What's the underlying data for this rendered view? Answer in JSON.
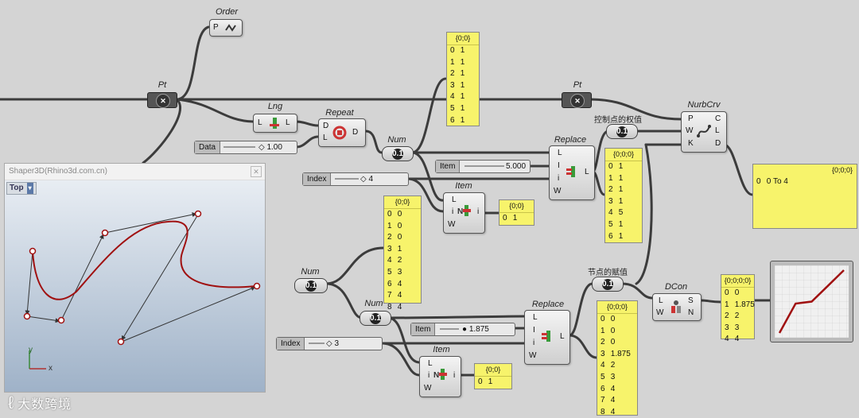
{
  "order": {
    "label": "Order",
    "port": "P"
  },
  "pt1": {
    "label": "Pt"
  },
  "lng": {
    "label": "Lng",
    "in": "L",
    "out": "L"
  },
  "repeat": {
    "label": "Repeat",
    "in1": "D",
    "in2": "L",
    "out": "D"
  },
  "num1": {
    "label": "Num",
    "badge": "0.1"
  },
  "data_slider": {
    "label": "Data",
    "value": "1.00"
  },
  "index1": {
    "label": "Index",
    "value": "4"
  },
  "item1": {
    "label": "Item",
    "in1": "L",
    "in2": "i",
    "in3": "W",
    "out": "i"
  },
  "panel_item1": {
    "header": "{0;0}",
    "rows": [
      {
        "i": "0",
        "v": "1"
      }
    ]
  },
  "panel_weights": {
    "header": "{0;0}",
    "rows": [
      {
        "i": "0",
        "v": "1"
      },
      {
        "i": "1",
        "v": "1"
      },
      {
        "i": "2",
        "v": "1"
      },
      {
        "i": "3",
        "v": "1"
      },
      {
        "i": "4",
        "v": "1"
      },
      {
        "i": "5",
        "v": "1"
      },
      {
        "i": "6",
        "v": "1"
      }
    ]
  },
  "pt2": {
    "label": "Pt"
  },
  "replace1": {
    "label": "Replace",
    "in1": "L",
    "in2": "I",
    "in3": "i",
    "in4": "W",
    "out": "L"
  },
  "item_slider1": {
    "label": "Item",
    "value": "5.000"
  },
  "weights_param": {
    "label": "控制点的权值",
    "badge": "0.1"
  },
  "panel_replace1": {
    "header": "{0;0;0}",
    "rows": [
      {
        "i": "0",
        "v": "1"
      },
      {
        "i": "1",
        "v": "1"
      },
      {
        "i": "2",
        "v": "1"
      },
      {
        "i": "3",
        "v": "1"
      },
      {
        "i": "4",
        "v": "5"
      },
      {
        "i": "5",
        "v": "1"
      },
      {
        "i": "6",
        "v": "1"
      }
    ]
  },
  "nurbcrv": {
    "label": "NurbCrv",
    "in1": "P",
    "in2": "W",
    "in3": "K",
    "out1": "C",
    "out2": "L",
    "out3": "D"
  },
  "panel_domain": {
    "header": "{0;0;0}",
    "rows": [
      {
        "i": "0",
        "v": "0 To 4"
      }
    ]
  },
  "rhino": {
    "title": "Shaper3D(Rhino3d.com.cn)",
    "view": "Top",
    "axis_y": "y",
    "axis_x": "x"
  },
  "num2": {
    "label": "Num",
    "badge": "0.1"
  },
  "num3": {
    "label": "Num",
    "badge": "0.1"
  },
  "panel_knots": {
    "header": "{0;0}",
    "rows": [
      {
        "i": "0",
        "v": "0"
      },
      {
        "i": "1",
        "v": "0"
      },
      {
        "i": "2",
        "v": "0"
      },
      {
        "i": "3",
        "v": "1"
      },
      {
        "i": "4",
        "v": "2"
      },
      {
        "i": "5",
        "v": "3"
      },
      {
        "i": "6",
        "v": "4"
      },
      {
        "i": "7",
        "v": "4"
      },
      {
        "i": "8",
        "v": "4"
      }
    ]
  },
  "replace2": {
    "label": "Replace",
    "in1": "L",
    "in2": "I",
    "in3": "i",
    "in4": "W",
    "out": "L"
  },
  "item_slider2": {
    "label": "Item",
    "value": "1.875"
  },
  "index2": {
    "label": "Index",
    "value": "3"
  },
  "item2": {
    "label": "Item",
    "in1": "L",
    "in2": "i",
    "in3": "W",
    "out": "i"
  },
  "panel_item2": {
    "header": "{0;0}",
    "rows": [
      {
        "i": "0",
        "v": "1"
      }
    ]
  },
  "knots_param": {
    "label": "节点的赋值",
    "badge": "0.1"
  },
  "panel_replace2": {
    "header": "{0;0;0}",
    "rows": [
      {
        "i": "0",
        "v": "0"
      },
      {
        "i": "1",
        "v": "0"
      },
      {
        "i": "2",
        "v": "0"
      },
      {
        "i": "3",
        "v": "1.875"
      },
      {
        "i": "4",
        "v": "2"
      },
      {
        "i": "5",
        "v": "3"
      },
      {
        "i": "6",
        "v": "4"
      },
      {
        "i": "7",
        "v": "4"
      },
      {
        "i": "8",
        "v": "4"
      }
    ]
  },
  "dcon": {
    "label": "DCon",
    "in1": "L",
    "in2": "W",
    "out1": "S",
    "out2": "N"
  },
  "panel_dcon": {
    "header": "{0;0;0;0}",
    "rows": [
      {
        "i": "0",
        "v": "0"
      },
      {
        "i": "1",
        "v": "1.875"
      },
      {
        "i": "2",
        "v": "2"
      },
      {
        "i": "3",
        "v": "3"
      },
      {
        "i": "4",
        "v": "4"
      }
    ]
  },
  "graph_points": [
    0,
    1.875,
    2,
    3,
    4
  ],
  "watermark": "大数跨境",
  "colors": {
    "canvas": "#d4d4d4",
    "panel": "#f7f36b",
    "curve": "#a01010"
  }
}
